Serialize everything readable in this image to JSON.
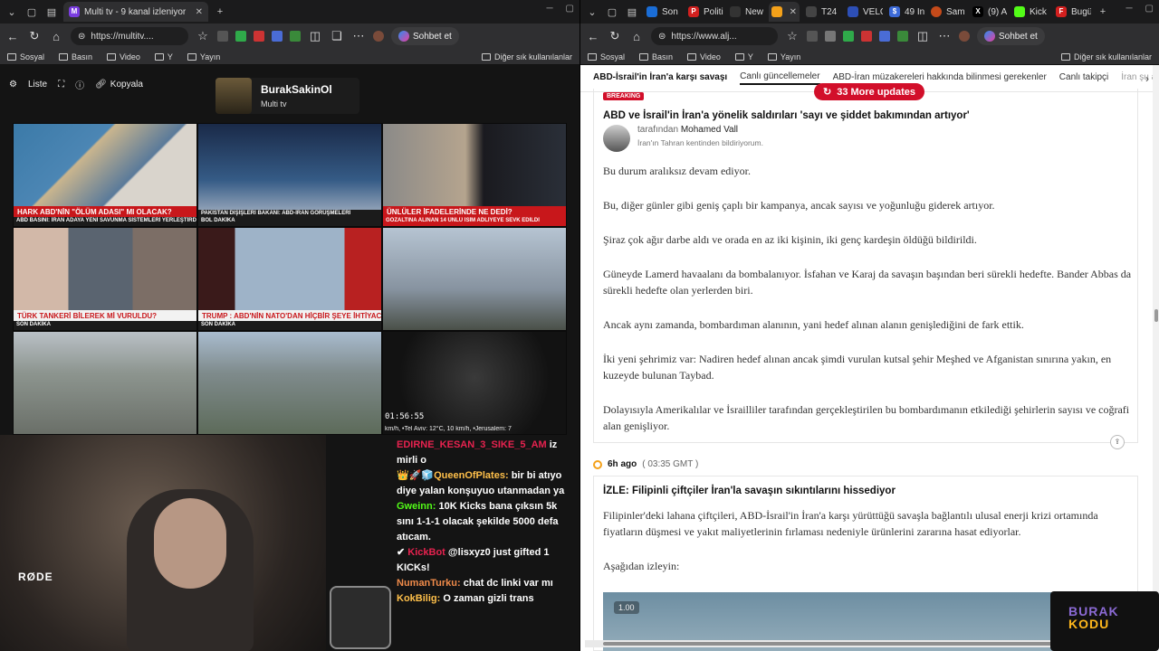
{
  "left_browser": {
    "active_tab": {
      "title": "Multi tv - 9 kanal izleniyor"
    },
    "url": "https://multitv....",
    "chat_button": "Sohbet et",
    "bookmarks": [
      "Sosyal",
      "Basın",
      "Video",
      "Y",
      "Yayın"
    ],
    "bookmarks_right": "Diğer sık kullanılanlar"
  },
  "right_browser": {
    "tabs": [
      "Son",
      "Politi",
      "New",
      "",
      "T24",
      "VELC",
      "49 In",
      "Sam",
      "(9) A",
      "Kick",
      "Bugü"
    ],
    "url": "https://www.alj...",
    "chat_button": "Sohbet et",
    "bookmarks": [
      "Sosyal",
      "Basın",
      "Video",
      "Y",
      "Yayın"
    ],
    "bookmarks_right": "Diğer sık kullanılanlar"
  },
  "multitv": {
    "toolbar": {
      "list": "Liste",
      "copy": "Kopyala"
    },
    "channel": {
      "name": "BurakSakinOl",
      "subtitle": "Multi tv"
    },
    "cells": [
      {
        "ticker": "HARK ABD'NİN \"ÖLÜM ADASI\" MI OLACAK?",
        "sub": "ABD BASINI: İRAN ADAYA YENİ SAVUNMA SİSTEMLERİ YERLEŞTİRDİ"
      },
      {
        "ticker": "PAKİSTAN DIŞİŞLERİ BAKANI: ABD-İRAN GÖRÜŞMELERİ",
        "sub": "BOL DAKİKA"
      },
      {
        "ticker": "ÜNLÜLER İFADELERİNDE NE DEDİ?",
        "sub": "GÖZALTINA ALINAN 14 ÜNLÜ İSİM ADLİYEYE SEVK EDİLDİ"
      },
      {
        "ticker": "TÜRK TANKERİ BİLEREK Mİ VURULDU?",
        "sub": "SON DAKİKA"
      },
      {
        "ticker": "TRUMP : ABD'NİN NATO'DAN HİÇBİR ŞEYE İHTİYACI YOK",
        "sub": "SON DAKİKA"
      },
      {
        "ticker": "",
        "sub": ""
      },
      {
        "ticker": "",
        "sub": ""
      },
      {
        "ticker": "",
        "sub": ""
      },
      {
        "ticker": "",
        "sub": "",
        "time": "01:56:55",
        "weather": "km/h, •Tel Aviv: 12°C, 10 km/h, •Jerusalem: 7"
      }
    ]
  },
  "stream": {
    "cam_brand": "RØDE",
    "chat": [
      {
        "user": "EDIRNE_KESAN_3_SIKE_5_AM",
        "text": "iz mirli o",
        "color": "pink"
      },
      {
        "user": "QueenOfPlates:",
        "text": "bir bi atıyo diye yalan konşuyuo utanmadan ya",
        "color": "gold"
      },
      {
        "user": "Gweinn:",
        "text": "10K Kicks bana çıksın 5k sını 1-1-1 olacak şekilde 5000 defa atıcam.",
        "color": "green"
      },
      {
        "user": "KickBot",
        "text": "@lisxyz0 just gifted 1 KICKs!",
        "color": "pink"
      },
      {
        "user": "NumanTurku:",
        "text": "chat dc linki var mı",
        "color": "orange"
      },
      {
        "user": "KokBilig:",
        "text": "O zaman gizli trans",
        "color": "gold"
      }
    ]
  },
  "aljazeera": {
    "tabs": [
      "ABD-İsrail'in İran'a karşı savaşı",
      "Canlı güncellemeler",
      "ABD-İran müzakereleri hakkında bilinmesi gerekenler",
      "Canlı takipçi",
      "İran şu anda dah"
    ],
    "updates_pill": "33 More updates",
    "post1": {
      "badge": "BREAKING",
      "headline": "ABD ve İsrail'in İran'a yönelik saldırıları 'sayı ve şiddet bakımından artıyor'",
      "author_prefix": "tarafından",
      "author": "Mohamed Vall",
      "location": "İran'ın Tahran kentinden bildiriyorum.",
      "paragraphs": [
        "Bu durum aralıksız devam ediyor.",
        "Bu, diğer günler gibi geniş çaplı bir kampanya, ancak sayısı ve yoğunluğu giderek artıyor.",
        "Şiraz çok ağır darbe aldı ve orada en az iki kişinin, iki genç kardeşin öldüğü bildirildi.",
        "Güneyde Lamerd havaalanı da bombalanıyor. İsfahan ve Karaj da savaşın başından beri sürekli hedefte. Bander Abbas da sürekli hedefte olan yerlerden biri.",
        "Ancak aynı zamanda, bombardıman alanının, yani hedef alınan alanın genişlediğini de fark ettik.",
        "İki yeni şehrimiz var: Nadiren hedef alınan ancak şimdi vurulan kutsal şehir Meşhed ve Afganistan sınırına yakın, en kuzeyde bulunan Taybad.",
        "Dolayısıyla Amerikalılar ve İsrailliler tarafından gerçekleştirilen bu bombardımanın etkilediği şehirlerin sayısı ve coğrafi alan genişliyor."
      ]
    },
    "post2": {
      "time": "6h ago",
      "gmt": "( 03:35 GMT )",
      "headline": "İZLE: Filipinli çiftçiler İran'la savaşın sıkıntılarını hissediyor",
      "paragraphs": [
        "Filipinler'deki lahana çiftçileri, ABD-İsrail'in İran'a karşı yürüttüğü savaşla bağlantılı ulusal enerji krizi ortamında fiyatların düşmesi ve yakıt maliyetlerinin fırlaması nedeniyle ürünlerini zararına hasat ediyorlar.",
        "Aşağıdan izleyin:"
      ],
      "video_speed": "1.00"
    }
  },
  "overlay_logo": {
    "line1": "BURAK",
    "line2": "KODU"
  }
}
